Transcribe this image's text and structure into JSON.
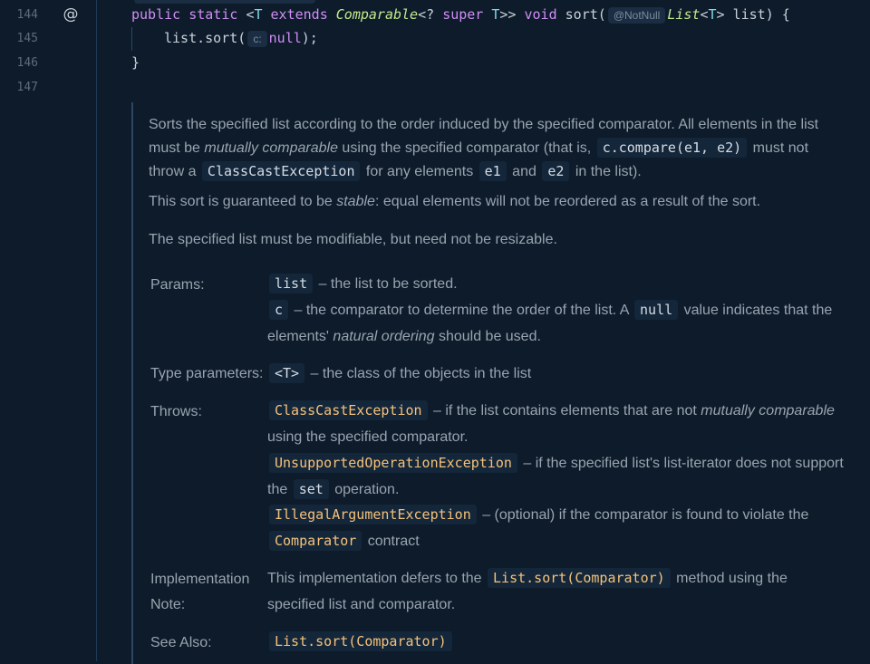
{
  "gutter": {
    "line_numbers": [
      "144",
      "145",
      "146",
      "147"
    ],
    "annotation_glyph": "@"
  },
  "code": {
    "line1": {
      "kw1": "public static ",
      "lt": "<",
      "tp1": "T",
      "kw2": " extends ",
      "type1": "Comparable",
      "rest1": "<? ",
      "kw3": "super",
      "rest2": " ",
      "tp2": "T",
      "rest3": ">> ",
      "kw4": "void",
      "rest4": " sort(",
      "hint": "@NotNull",
      "type2": "List",
      "rest5": "<",
      "tp3": "T",
      "rest6": "> list) {"
    },
    "line2": {
      "pre": "list.sort(",
      "hint": "c:",
      "kw": "null",
      "post": ");"
    },
    "line3": "}"
  },
  "doc": {
    "para1": {
      "t1": "Sorts the specified list according to the order induced by the specified comparator. All elements in the list must be ",
      "em1": "mutually comparable",
      "t2": " using the specified comparator (that is, ",
      "c1": "c.compare(e1, e2)",
      "t3": " must not throw a ",
      "c2": "ClassCastException",
      "t4": " for any elements ",
      "c3": "e1",
      "t5": " and ",
      "c4": "e2",
      "t6": " in the list)."
    },
    "para2": {
      "t1": "This sort is guaranteed to be ",
      "em1": "stable",
      "t2": ": equal elements will not be reordered as a result of the sort."
    },
    "para3": "The specified list must be modifiable, but need not be resizable.",
    "params_label": "Params:",
    "param_list_code": "list",
    "param_list_desc": " – the list to be sorted.",
    "param_c_code": "c",
    "param_c_desc1": " – the comparator to determine the order of the list. A ",
    "param_c_null": "null",
    "param_c_desc2": " value indicates that the elements' ",
    "param_c_em": "natural ordering",
    "param_c_desc3": " should be used.",
    "type_params_label": "Type parameters:",
    "type_param_code": "<T>",
    "type_param_desc": " – the class of the objects in the list",
    "throws_label": "Throws:",
    "throws1_code": "ClassCastException",
    "throws1_desc1": " – if the list contains elements that are not ",
    "throws1_em": "mutually comparable",
    "throws1_desc2": " using the specified comparator.",
    "throws2_code": "UnsupportedOperationException",
    "throws2_desc1": " – if the specified list's list-iterator does not support the ",
    "throws2_set": "set",
    "throws2_desc2": " operation.",
    "throws3_code": "IllegalArgumentException",
    "throws3_desc1": " – (optional) if the comparator is found to violate the ",
    "throws3_cmp": "Comparator",
    "throws3_desc2": " contract",
    "impl_label": "Implementation Note:",
    "impl_desc1": "This implementation defers to the ",
    "impl_code": "List.sort(Comparator)",
    "impl_desc2": " method using the specified list and comparator.",
    "see_label": "See Also:",
    "see_code": "List.sort(Comparator)"
  },
  "colors": {
    "background": "#0d1b2a",
    "keyword": "#cf8ef4",
    "type": "#c3e88d",
    "type_param": "#7fd8e6",
    "exception": "#f5c27a"
  }
}
